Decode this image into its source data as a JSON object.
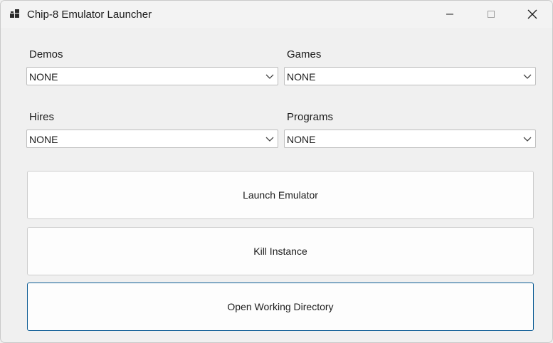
{
  "window": {
    "title": "Chip-8 Emulator Launcher",
    "icon": "app-window-icon",
    "controls": [
      "minimize-icon",
      "maximize-icon",
      "close-icon"
    ]
  },
  "demos": {
    "label": "Demos",
    "value": "NONE"
  },
  "games": {
    "label": "Games",
    "value": "NONE"
  },
  "hires": {
    "label": "Hires",
    "value": "NONE"
  },
  "programs": {
    "label": "Programs",
    "value": "NONE"
  },
  "buttons": {
    "launch": "Launch Emulator",
    "kill": "Kill Instance",
    "open_dir": "Open Working Directory"
  },
  "colors": {
    "focus_border": "#0f5e96",
    "window_bg": "#f0f0f0"
  }
}
